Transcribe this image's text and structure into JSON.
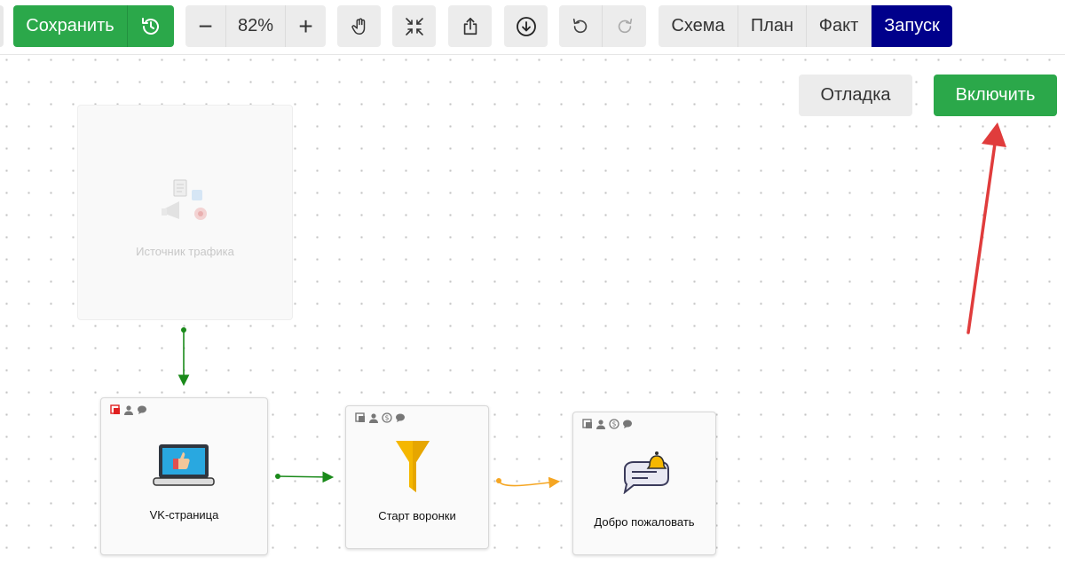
{
  "toolbar": {
    "save_label": "Сохранить",
    "zoom_value": "82%",
    "zoom_minus": "−",
    "zoom_plus": "+",
    "modes": [
      {
        "label": "Схема",
        "active": false
      },
      {
        "label": "План",
        "active": false
      },
      {
        "label": "Факт",
        "active": false
      },
      {
        "label": "Запуск",
        "active": true
      }
    ]
  },
  "canvas": {
    "debug_label": "Отладка",
    "enable_label": "Включить",
    "nodes": {
      "traffic_source": "Источник трафика",
      "vk_page": "VK-страница",
      "funnel_start": "Старт воронки",
      "welcome": "Добро пожаловать"
    }
  },
  "icons": {
    "history": "history-icon",
    "hand": "hand-pointer-icon",
    "collapse": "collapse-arrows-icon",
    "share": "share-upload-icon",
    "download": "download-circle-icon",
    "undo": "undo-icon",
    "redo": "redo-icon"
  },
  "colors": {
    "accent_green": "#2ba84a",
    "active_tab": "#00008b",
    "arrow_red": "#e03c3c",
    "link_green": "#1a8a1a",
    "link_orange": "#f5a623"
  }
}
